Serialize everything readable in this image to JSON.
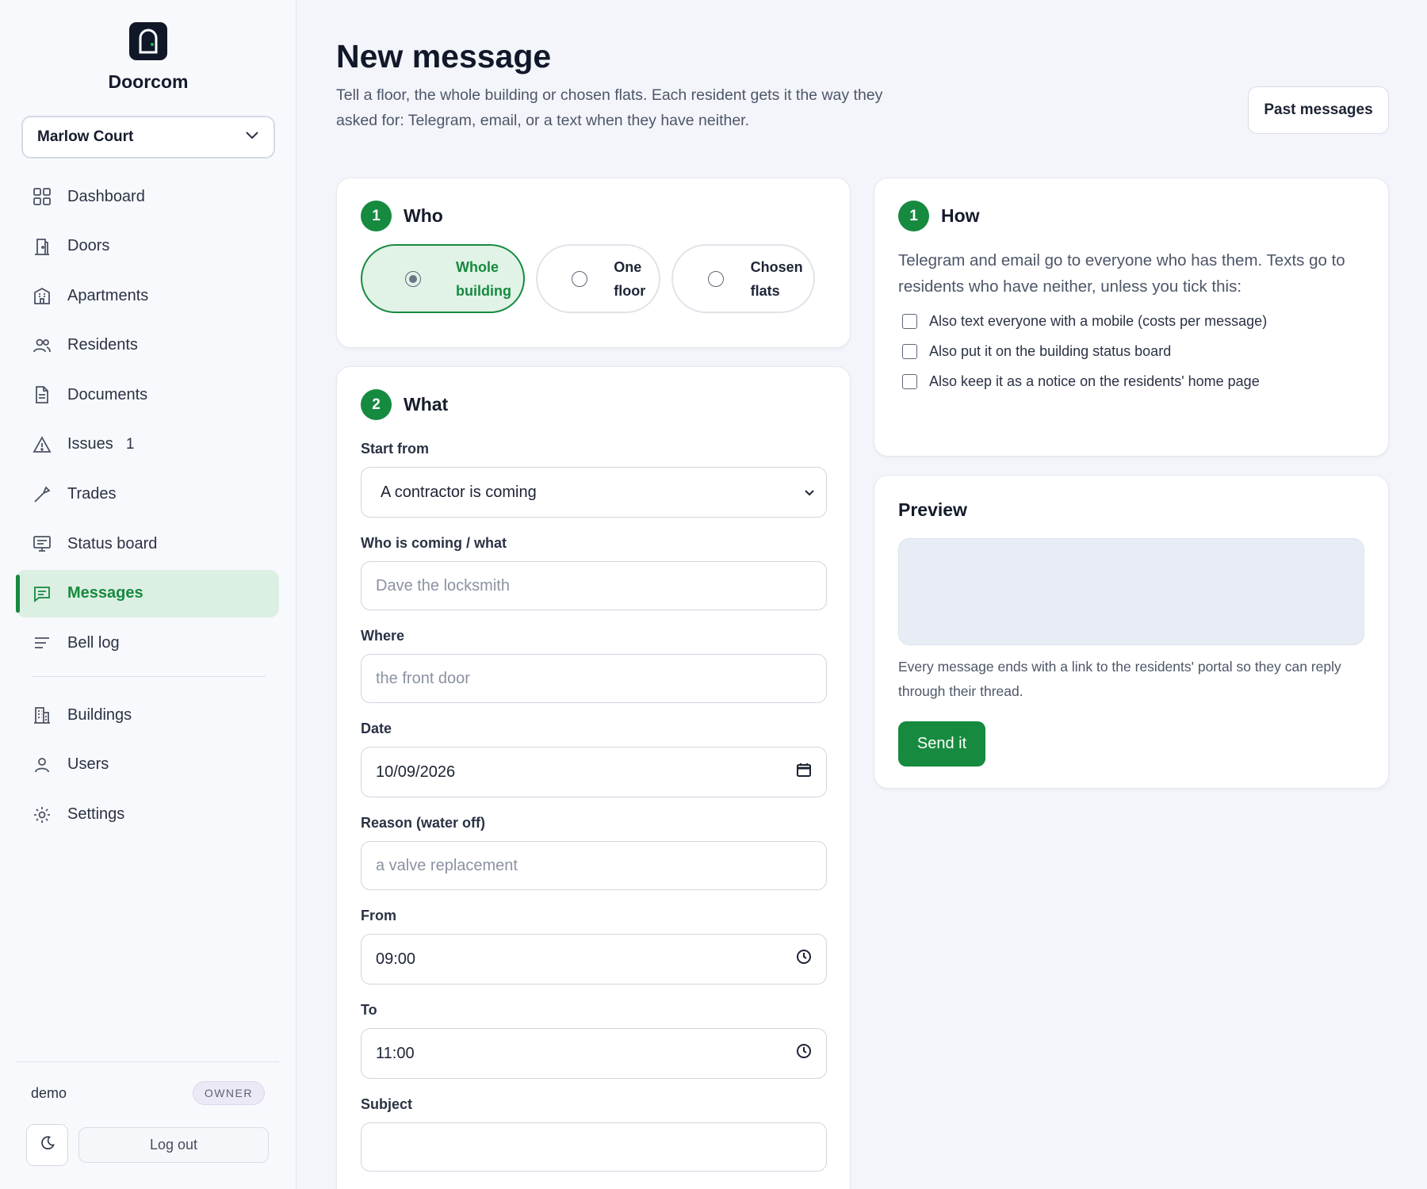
{
  "app": {
    "name": "Doorcom",
    "logo_icon": "door-icon"
  },
  "building_selector": {
    "value": "Marlow Court",
    "icon": "chevron-down-icon"
  },
  "nav": {
    "items": [
      {
        "label": "Dashboard",
        "icon": "grid-icon",
        "active": false
      },
      {
        "label": "Doors",
        "icon": "door-icon",
        "active": false
      },
      {
        "label": "Apartments",
        "icon": "apartment-icon",
        "active": false
      },
      {
        "label": "Residents",
        "icon": "people-icon",
        "active": false
      },
      {
        "label": "Documents",
        "icon": "document-icon",
        "active": false
      },
      {
        "label": "Issues",
        "icon": "warning-icon",
        "badge": "1",
        "active": false
      },
      {
        "label": "Trades",
        "icon": "wrench-icon",
        "active": false
      },
      {
        "label": "Status board",
        "icon": "monitor-icon",
        "active": false
      },
      {
        "label": "Messages",
        "icon": "message-icon",
        "active": true
      },
      {
        "label": "Bell log",
        "icon": "list-icon",
        "active": false
      }
    ],
    "secondary": [
      {
        "label": "Buildings",
        "icon": "building-icon"
      },
      {
        "label": "Users",
        "icon": "user-icon"
      },
      {
        "label": "Settings",
        "icon": "gear-icon"
      }
    ]
  },
  "footer": {
    "user": "demo",
    "role": "OWNER",
    "logout_label": "Log out",
    "theme_icon": "moon-icon"
  },
  "header": {
    "title": "New message",
    "description": "Tell a floor, the whole building or chosen flats. Each resident gets it the way they asked for: Telegram, email, or a text when they have neither.",
    "past_button": "Past messages"
  },
  "who": {
    "step": "1",
    "title": "Who",
    "options": [
      {
        "label": "Whole\nbuilding",
        "selected": true
      },
      {
        "label": "One\nfloor",
        "selected": false
      },
      {
        "label": "Chosen\nflats",
        "selected": false
      }
    ]
  },
  "what": {
    "step": "2",
    "title": "What",
    "fields": {
      "start_from": {
        "label": "Start from",
        "value": "A contractor is coming"
      },
      "who_coming": {
        "label": "Who is coming / what",
        "placeholder": "Dave the locksmith"
      },
      "where": {
        "label": "Where",
        "placeholder": "the front door"
      },
      "date": {
        "label": "Date",
        "value": "10/09/2026"
      },
      "reason": {
        "label": "Reason (water off)",
        "placeholder": "a valve replacement"
      },
      "from": {
        "label": "From",
        "value": "09:00"
      },
      "to": {
        "label": "To",
        "value": "11:00"
      },
      "subject": {
        "label": "Subject",
        "value": ""
      }
    }
  },
  "how": {
    "step": "1",
    "title": "How",
    "description": "Telegram and email go to everyone who has them. Texts go to residents who have neither, unless you tick this:",
    "options": [
      {
        "label": "Also text everyone with a mobile (costs per message)",
        "checked": false
      },
      {
        "label": "Also put it on the building status board",
        "checked": false
      },
      {
        "label": "Also keep it as a notice on the residents' home page",
        "checked": false
      }
    ]
  },
  "preview": {
    "title": "Preview",
    "note": "Every message ends with a link to the residents' portal so they can reply through their thread.",
    "send_label": "Send it"
  },
  "colors": {
    "accent": "#168a3f",
    "accent_light": "#dcefe3",
    "background": "#f3f5fa"
  }
}
